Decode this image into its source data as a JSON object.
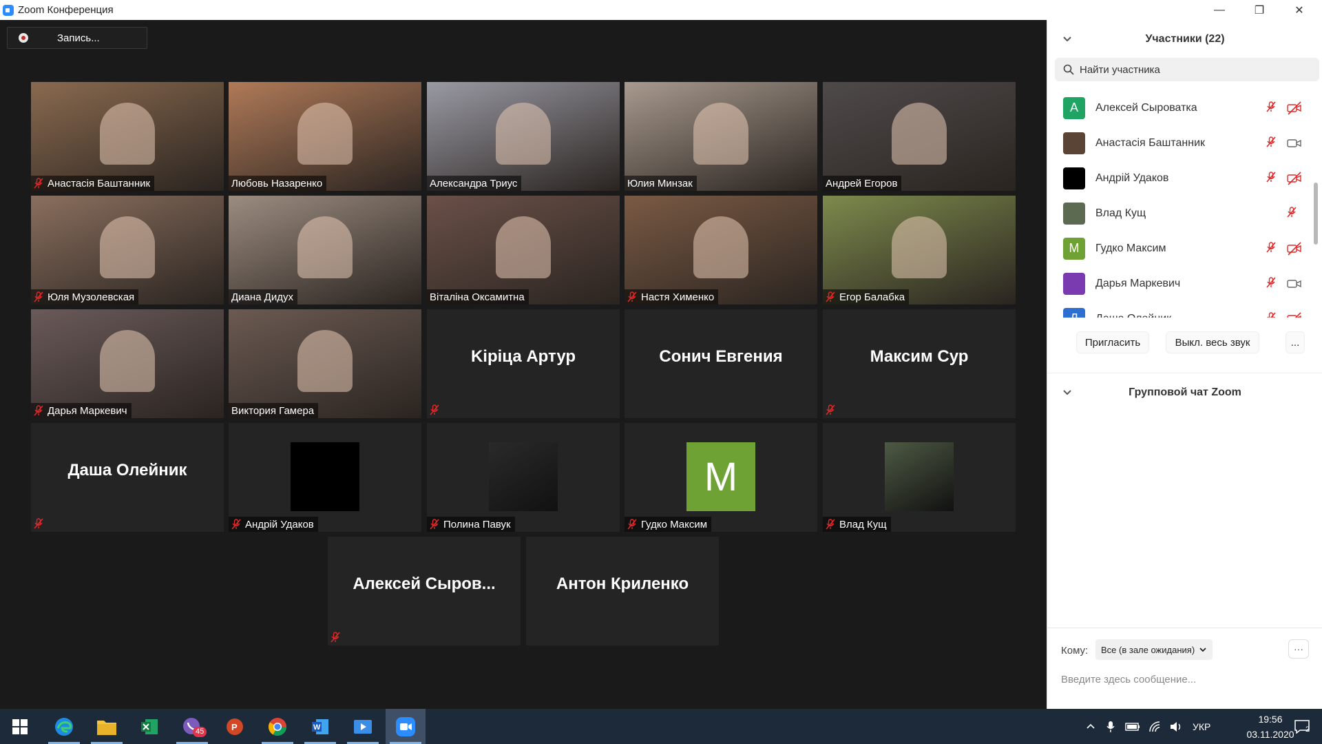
{
  "window": {
    "title": "Zoom Конференция"
  },
  "recording": {
    "label": "Запись..."
  },
  "participants_panel": {
    "title": "Участники (22)",
    "search_placeholder": "Найти участника",
    "list": [
      {
        "name": "Алексей Сыроватка",
        "initial": "A",
        "avatar_color": "#1fa463",
        "mic": "muted",
        "video": "off"
      },
      {
        "name": "Анастасія Баштанник",
        "initial": "",
        "avatar_color": "#5a4436",
        "mic": "muted",
        "video": "on"
      },
      {
        "name": "Андрій Удаков",
        "initial": "",
        "avatar_color": "#000000",
        "mic": "muted",
        "video": "off"
      },
      {
        "name": "Влад Кущ",
        "initial": "",
        "avatar_color": "#5d6a52",
        "mic": "muted",
        "video": "none"
      },
      {
        "name": "Гудко Максим",
        "initial": "M",
        "avatar_color": "#6fa234",
        "mic": "muted",
        "video": "off"
      },
      {
        "name": "Дарья Маркевич",
        "initial": "",
        "avatar_color": "#7a3bb0",
        "mic": "muted",
        "video": "on"
      },
      {
        "name": "Даша Олейник",
        "initial": "Д",
        "avatar_color": "#2d6fd1",
        "mic": "muted",
        "video": "off"
      }
    ],
    "invite_label": "Пригласить",
    "mute_all_label": "Выкл. весь звук",
    "more_label": "..."
  },
  "chat": {
    "title": "Групповой чат Zoom",
    "to_label": "Кому:",
    "to_value": "Все (в зале ожидания)",
    "more_label": "···",
    "input_placeholder": "Введите здесь сообщение..."
  },
  "gallery": [
    {
      "name": "Анастасія Баштанник",
      "type": "video",
      "muted": true,
      "color": "#8a6a4f"
    },
    {
      "name": "Любовь Назаренко",
      "type": "video",
      "muted": false,
      "active": true,
      "color": "#b07a58"
    },
    {
      "name": "Александра Триус",
      "type": "video",
      "muted": false,
      "color": "#9a9aa4"
    },
    {
      "name": "Юлия Минзак",
      "type": "video",
      "muted": false,
      "color": "#a89a8e"
    },
    {
      "name": "Андрей Егоров",
      "type": "video",
      "muted": false,
      "color": "#4f4a4a"
    },
    {
      "name": "Юля Музолевская",
      "type": "video",
      "muted": true,
      "color": "#8a6f5e"
    },
    {
      "name": "Диана Дидух",
      "type": "video",
      "muted": false,
      "color": "#9c8c80"
    },
    {
      "name": "Віталіна Оксамитна",
      "type": "video",
      "muted": false,
      "color": "#6a5048"
    },
    {
      "name": "Настя Хименко",
      "type": "video",
      "muted": true,
      "color": "#7a5a44"
    },
    {
      "name": "Егор Балабка",
      "type": "video",
      "muted": true,
      "color": "#7d8a4c"
    },
    {
      "name": "Дарья Маркевич",
      "type": "video",
      "muted": true,
      "color": "#6a5a5a"
    },
    {
      "name": "Виктория Гамера",
      "type": "video",
      "muted": false,
      "color": "#6b5a52"
    },
    {
      "name": "Kіріца Артур",
      "type": "name",
      "muted": true
    },
    {
      "name": "Сонич Евгения",
      "type": "name",
      "muted": false
    },
    {
      "name": "Максим Сур",
      "type": "name",
      "muted": true
    },
    {
      "name": "Даша Олейник",
      "type": "name",
      "muted": true
    },
    {
      "name": "Андрій Удаков",
      "type": "black",
      "muted": true
    },
    {
      "name": "Полина Павук",
      "type": "photo",
      "muted": true,
      "color": "#2a2a2a"
    },
    {
      "name": "Гудко Максим",
      "type": "avatar",
      "initial": "M",
      "muted": true
    },
    {
      "name": "Влад Кущ",
      "type": "photo",
      "muted": true,
      "color": "#4e5a44"
    },
    {
      "name": "Алексей  Сыров...",
      "type": "name",
      "muted": true
    },
    {
      "name": "Антон Криленко",
      "type": "name",
      "muted": false
    }
  ],
  "taskbar": {
    "apps": [
      "windows-start",
      "edge",
      "file-explorer",
      "excel",
      "viber",
      "powerpoint",
      "chrome",
      "word",
      "media-player",
      "zoom"
    ],
    "viber_badge": "45",
    "language": "УКР",
    "time": "19:56",
    "date": "03.11.2020",
    "notification_count": "2"
  },
  "colors": {
    "accent_active": "#d4e35a",
    "muted_red": "#e02828",
    "taskbar": "#1c2a3a"
  }
}
